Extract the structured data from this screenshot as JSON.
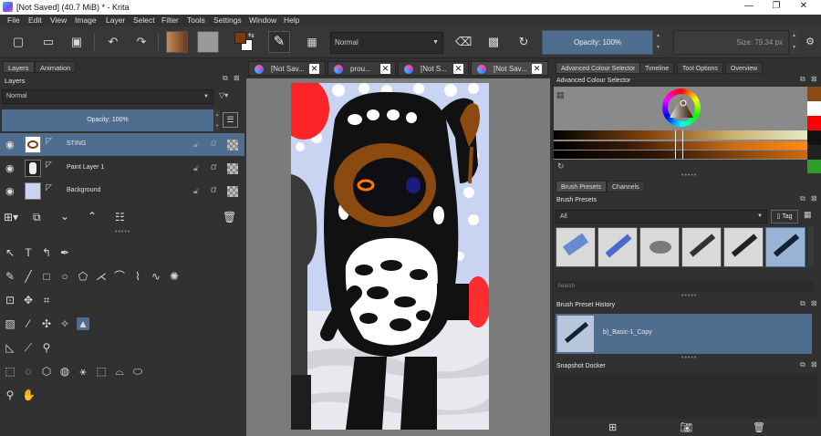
{
  "window": {
    "title": "[Not Saved]  (40.7 MiB)  * - Krita",
    "controls": [
      "—",
      "❐",
      "✕"
    ]
  },
  "menu": [
    "File",
    "Edit",
    "View",
    "Image",
    "Layer",
    "Select",
    "Filter",
    "Tools",
    "Settings",
    "Window",
    "Help"
  ],
  "toolbar": {
    "blend_mode": "Normal",
    "opacity_label": "Opacity:  100%",
    "size_label": "Size:  79.34 px"
  },
  "left_panel": {
    "tabs": [
      "Layers",
      "Animation"
    ],
    "docker_title": "Layers",
    "blend_mode": "Normal",
    "opacity_label": "Opacity:  100%",
    "layers": [
      {
        "name": "STING",
        "selected": true
      },
      {
        "name": "Paint Layer 1",
        "selected": false
      },
      {
        "name": "Background",
        "selected": false
      }
    ]
  },
  "document_tabs": [
    "[Not Sav...",
    "prou...",
    "[Not S...",
    "[Not Sav..."
  ],
  "right_panel": {
    "tabs": [
      "Advanced Colour Selector",
      "Timeline",
      "Tool Options",
      "Overview"
    ],
    "colour_selector_title": "Advanced Colour Selector",
    "sub_tabs": [
      "Brush Presets",
      "Channels"
    ],
    "brush_presets_title": "Brush Presets",
    "brush_filter": "All",
    "tag_label": "Tag",
    "search_placeholder": "Search",
    "history_title": "Brush Preset History",
    "history_item": "b)_Basic-1_Copy",
    "snapshot_title": "Snapshot Docker"
  },
  "colors": {
    "accent": "#4f6e8f",
    "foreground": "#7a3c10",
    "background": "#ffffff",
    "panel": "#313131",
    "canvas_bg": "#7b7b7b"
  }
}
